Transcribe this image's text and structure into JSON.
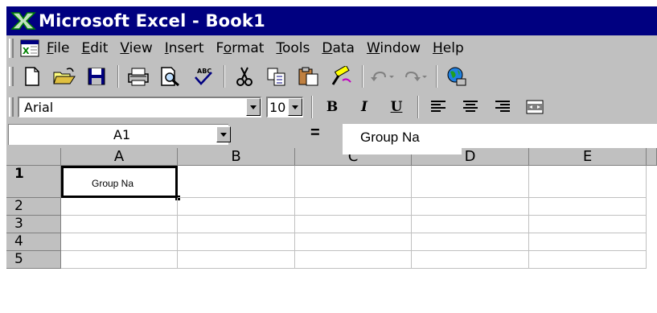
{
  "titlebar": {
    "title": "Microsoft Excel - Book1",
    "icon": "excel-x-icon"
  },
  "menubar": {
    "items": [
      {
        "label_acc": "F",
        "label_rest": "ile"
      },
      {
        "label_acc": "E",
        "label_rest": "dit"
      },
      {
        "label_acc": "V",
        "label_rest": "iew"
      },
      {
        "label_acc": "I",
        "label_rest": "nsert"
      },
      {
        "label_pre": "F",
        "label_acc": "o",
        "label_rest": "rmat"
      },
      {
        "label_acc": "T",
        "label_rest": "ools"
      },
      {
        "label_acc": "D",
        "label_rest": "ata"
      },
      {
        "label_acc": "W",
        "label_rest": "indow"
      },
      {
        "label_acc": "H",
        "label_rest": "elp"
      }
    ]
  },
  "standard_toolbar": {
    "icons": [
      "new-icon",
      "open-icon",
      "save-icon",
      "print-icon",
      "print-preview-icon",
      "spelling-icon",
      "cut-icon",
      "copy-icon",
      "paste-icon",
      "format-painter-icon",
      "undo-icon",
      "redo-icon",
      "web-icon"
    ]
  },
  "formatting_toolbar": {
    "font": "Arial",
    "size": "10",
    "bold": "B",
    "italic": "I",
    "underline": "U"
  },
  "formula_bar": {
    "name_box": "A1",
    "equals": "=",
    "content": "Group Na"
  },
  "sheet": {
    "columns": [
      "A",
      "B",
      "C",
      "D",
      "E"
    ],
    "rows": [
      "1",
      "2",
      "3",
      "4",
      "5"
    ],
    "active_cell": "A1",
    "cells": {
      "A1": "Group Na"
    }
  },
  "colors": {
    "titlebar": "#000080",
    "chrome": "#c0c0c0"
  }
}
